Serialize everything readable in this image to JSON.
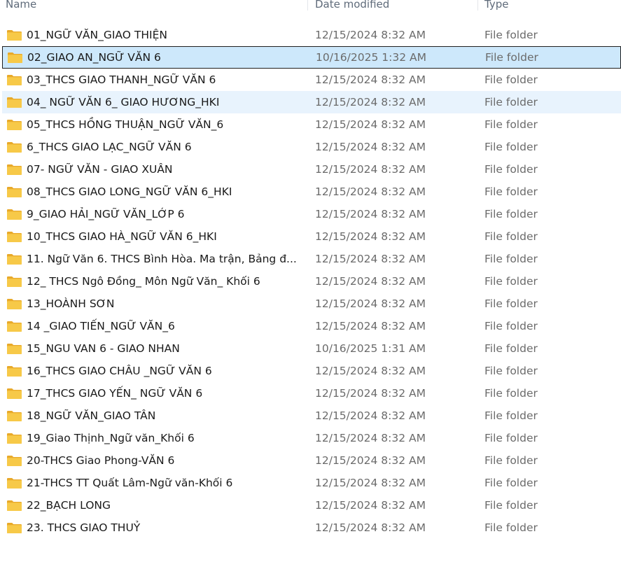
{
  "header": {
    "name_label": "Name",
    "date_label": "Date modified",
    "type_label": "Type"
  },
  "icon": "folder-icon",
  "colors": {
    "selected_bg": "#cde8fb",
    "hover_bg": "#e8f3fd",
    "folder_yellow": "#f7c948"
  },
  "rows": [
    {
      "name": "01_NGỮ VĂN_GIAO THIỆN",
      "date": "12/15/2024 8:32 AM",
      "type": "File folder",
      "state": ""
    },
    {
      "name": "02_GIAO AN_NGỮ VĂN 6",
      "date": "10/16/2025 1:32 AM",
      "type": "File folder",
      "state": "selected"
    },
    {
      "name": "03_THCS GIAO THANH_NGỮ VĂN 6",
      "date": "12/15/2024 8:32 AM",
      "type": "File folder",
      "state": ""
    },
    {
      "name": "04_ NGỮ VĂN 6_ GIAO HƯƠNG_HKI",
      "date": "12/15/2024 8:32 AM",
      "type": "File folder",
      "state": "hover"
    },
    {
      "name": "05_THCS HỒNG THUẬN_NGỮ VĂN_6",
      "date": "12/15/2024 8:32 AM",
      "type": "File folder",
      "state": ""
    },
    {
      "name": "6_THCS GIAO LẠC_NGỮ VĂN 6",
      "date": "12/15/2024 8:32 AM",
      "type": "File folder",
      "state": ""
    },
    {
      "name": "07- NGỮ VĂN - GIAO XUÂN",
      "date": "12/15/2024 8:32 AM",
      "type": "File folder",
      "state": ""
    },
    {
      "name": "08_THCS GIAO LONG_NGỮ VĂN 6_HKI",
      "date": "12/15/2024 8:32 AM",
      "type": "File folder",
      "state": ""
    },
    {
      "name": "9_GIAO HẢI_NGỮ VĂN_LỚP 6",
      "date": "12/15/2024 8:32 AM",
      "type": "File folder",
      "state": ""
    },
    {
      "name": "10_THCS GIAO HÀ_NGỮ VĂN 6_HKI",
      "date": "12/15/2024 8:32 AM",
      "type": "File folder",
      "state": ""
    },
    {
      "name": "11. Ngữ Văn 6. THCS Bình Hòa. Ma trận, Bảng đ...",
      "date": "12/15/2024 8:32 AM",
      "type": "File folder",
      "state": ""
    },
    {
      "name": "12_ THCS Ngô Đồng_ Môn Ngữ Văn_ Khối 6",
      "date": "12/15/2024 8:32 AM",
      "type": "File folder",
      "state": ""
    },
    {
      "name": "13_HOÀNH SƠN",
      "date": "12/15/2024 8:32 AM",
      "type": "File folder",
      "state": ""
    },
    {
      "name": "14 _GIAO TIẾN_NGỮ VĂN_6",
      "date": "12/15/2024 8:32 AM",
      "type": "File folder",
      "state": ""
    },
    {
      "name": "15_NGU VAN 6 - GIAO NHAN",
      "date": "10/16/2025 1:31 AM",
      "type": "File folder",
      "state": ""
    },
    {
      "name": "16_THCS GIAO CHÂU _NGỮ VĂN 6",
      "date": "12/15/2024 8:32 AM",
      "type": "File folder",
      "state": ""
    },
    {
      "name": "17_THCS GIAO YẾN_ NGỮ VĂN 6",
      "date": "12/15/2024 8:32 AM",
      "type": "File folder",
      "state": ""
    },
    {
      "name": "18_NGỮ VĂN_GIAO TÂN",
      "date": "12/15/2024 8:32 AM",
      "type": "File folder",
      "state": ""
    },
    {
      "name": "19_Giao Thịnh_Ngữ văn_Khối 6",
      "date": "12/15/2024 8:32 AM",
      "type": "File folder",
      "state": ""
    },
    {
      "name": "20-THCS Giao Phong-VĂN 6",
      "date": "12/15/2024 8:32 AM",
      "type": "File folder",
      "state": ""
    },
    {
      "name": "21-THCS TT Quất Lâm-Ngữ văn-Khối 6",
      "date": "12/15/2024 8:32 AM",
      "type": "File folder",
      "state": ""
    },
    {
      "name": "22_BẠCH LONG",
      "date": "12/15/2024 8:32 AM",
      "type": "File folder",
      "state": ""
    },
    {
      "name": "23. THCS GIAO THUỶ",
      "date": "12/15/2024 8:32 AM",
      "type": "File folder",
      "state": ""
    }
  ]
}
